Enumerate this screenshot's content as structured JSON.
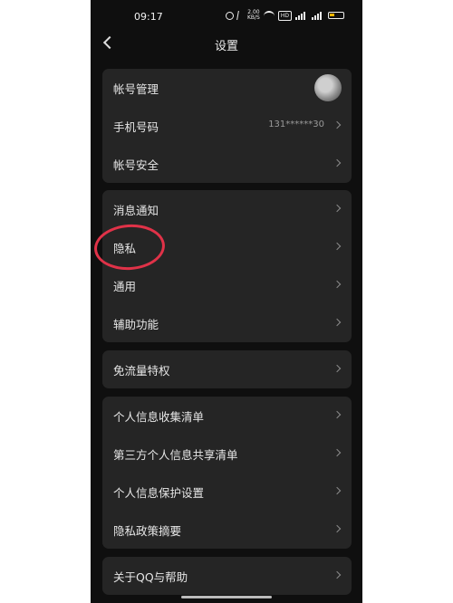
{
  "status_bar": {
    "time": "09:17",
    "speed": "2.00\nKB/S",
    "hd": "HD",
    "icons": [
      "alarm-icon",
      "bluetooth-icon",
      "network-speed",
      "wifi-icon",
      "hd-icon",
      "signal-icon",
      "signal-icon",
      "battery-icon"
    ]
  },
  "nav": {
    "title": "设置",
    "back_icon": "chevron-left-icon"
  },
  "groups": [
    {
      "rows": [
        {
          "label": "帐号管理",
          "trailing": "avatar"
        },
        {
          "label": "手机号码",
          "value": "131******30"
        },
        {
          "label": "帐号安全"
        }
      ]
    },
    {
      "rows": [
        {
          "label": "消息通知"
        },
        {
          "label": "隐私",
          "highlighted": true
        },
        {
          "label": "通用"
        },
        {
          "label": "辅助功能"
        }
      ]
    },
    {
      "rows": [
        {
          "label": "免流量特权"
        }
      ]
    },
    {
      "rows": [
        {
          "label": "个人信息收集清单"
        },
        {
          "label": "第三方个人信息共享清单"
        },
        {
          "label": "个人信息保护设置"
        },
        {
          "label": "隐私政策摘要"
        }
      ]
    },
    {
      "rows": [
        {
          "label": "关于QQ与帮助"
        }
      ]
    }
  ],
  "colors": {
    "background": "#0f0f0f",
    "card": "#252525",
    "text": "#e6e6e6",
    "annotation": "#e03248"
  }
}
